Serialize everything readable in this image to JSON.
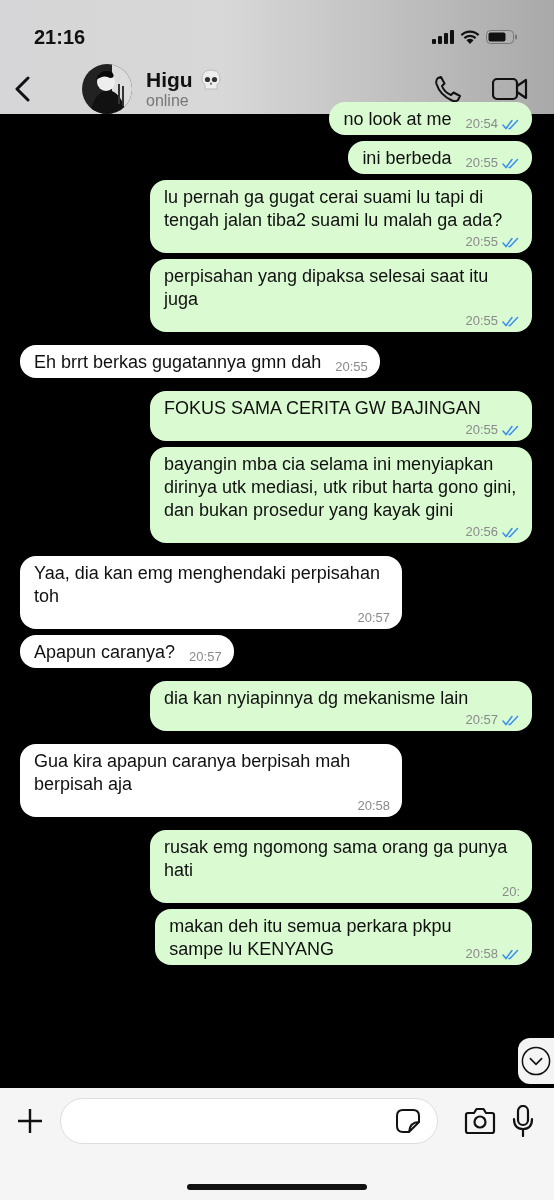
{
  "status_bar": {
    "time": "21:16"
  },
  "header": {
    "name": "Higu",
    "status": "online"
  },
  "messages": [
    {
      "kind": "out",
      "text": "no look at me",
      "time": "20:54",
      "read": true
    },
    {
      "kind": "out",
      "text": "ini berbeda",
      "time": "20:55",
      "read": true
    },
    {
      "kind": "out",
      "text": "lu pernah ga gugat cerai suami lu tapi di tengah jalan tiba2 suami lu malah ga ada?",
      "time": "20:55",
      "read": true
    },
    {
      "kind": "out",
      "text": "perpisahan yang dipaksa selesai saat itu juga",
      "time": "20:55",
      "read": true
    },
    {
      "kind": "in",
      "text": "Eh brrt berkas gugatannya gmn dah",
      "time": "20:55"
    },
    {
      "kind": "out",
      "text": "FOKUS SAMA CERITA GW BAJINGAN",
      "time": "20:55",
      "read": true
    },
    {
      "kind": "out",
      "text": "bayangin mba cia selama ini menyiapkan dirinya utk mediasi, utk ribut harta gono gini, dan bukan prosedur yang kayak gini",
      "time": "20:56",
      "read": true
    },
    {
      "kind": "in",
      "text": "Yaa, dia kan emg menghendaki perpisahan toh",
      "time": "20:57"
    },
    {
      "kind": "in",
      "text": "Apapun caranya?",
      "time": "20:57"
    },
    {
      "kind": "out",
      "text": "dia kan nyiapinnya dg mekanisme lain",
      "time": "20:57",
      "read": true
    },
    {
      "kind": "in",
      "text": "Gua kira apapun caranya berpisah mah berpisah aja",
      "time": "20:58"
    },
    {
      "kind": "out",
      "text": "rusak emg ngomong sama orang ga punya hati",
      "time": "20:"
    },
    {
      "kind": "out",
      "text": "makan deh itu semua perkara pkpu",
      "text2": "sampe lu KENYANG",
      "time": "20:58",
      "read": true
    }
  ]
}
